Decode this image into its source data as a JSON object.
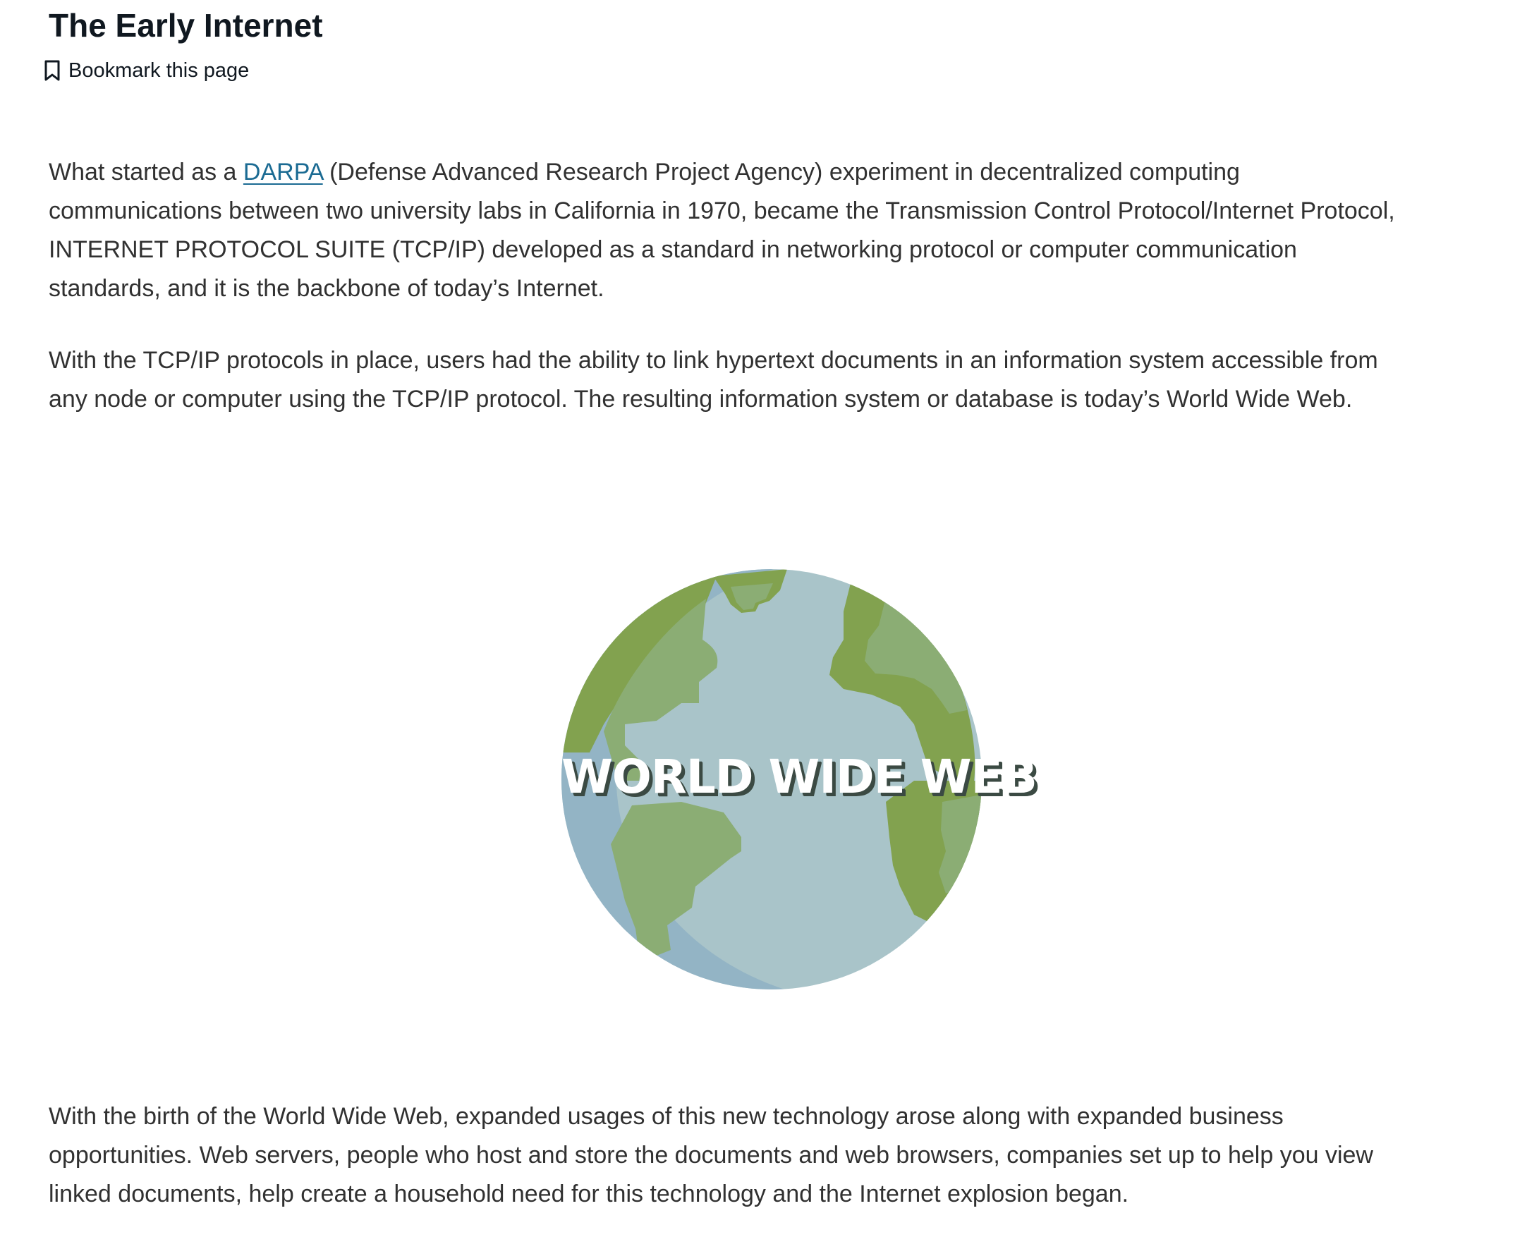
{
  "header": {
    "title": "The Early Internet",
    "bookmark_label": "Bookmark this page"
  },
  "content": {
    "p1": {
      "before_link": "What started as a ",
      "link_text": "DARPA",
      "after_link": " (Defense Advanced Research Project Agency) experiment in decentralized computing communications between two university labs in California in 1970, became the Transmission Control Protocol/Internet Protocol, INTERNET PROTOCOL SUITE (TCP/IP) developed as a standard in networking protocol or computer communication standards, and it is the backbone of today’s Internet."
    },
    "p2": "With the TCP/IP protocols in place, users had the ability to link hypertext documents in an information system accessible from any node or computer using the TCP/IP protocol. The resulting information system or database is today’s World Wide Web.",
    "image": {
      "caption_text": "WORLD WIDE WEB",
      "icon": "globe-icon"
    },
    "p3": "With the birth of the World Wide Web, expanded usages of this new technology arose along with expanded business opportunities. Web servers, people who host and store the documents and web browsers, companies set up to help you view linked documents, help create a household need for this technology and the Internet explosion began."
  },
  "colors": {
    "link": "#1b6b93",
    "title": "#101820",
    "body_text": "#313131",
    "ocean_light": "#a9c4c9",
    "ocean_dark": "#93b4c5",
    "land_light": "#8bad74",
    "land_dark": "#82a24f"
  }
}
